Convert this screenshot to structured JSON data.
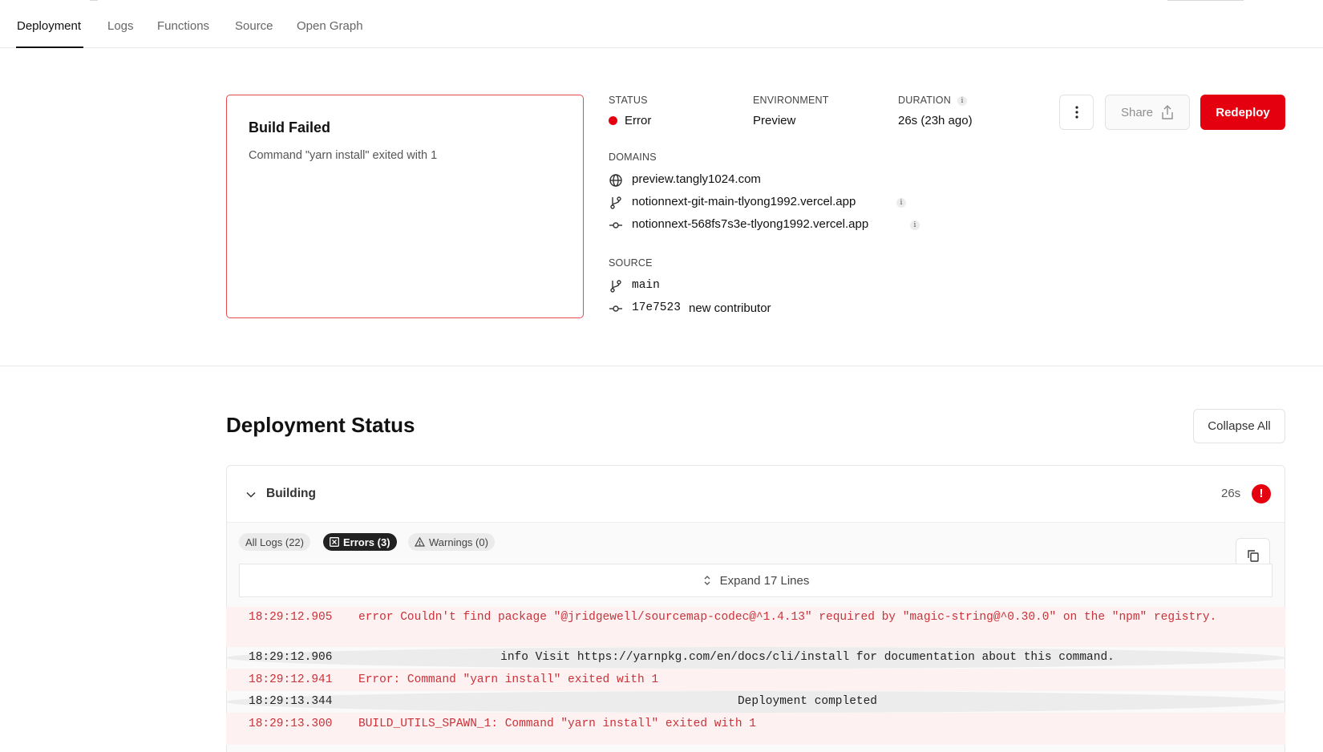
{
  "tabs": [
    "Deployment",
    "Logs",
    "Functions",
    "Source",
    "Open Graph"
  ],
  "build_card": {
    "title": "Build Failed",
    "description": "Command \"yarn install\" exited with 1"
  },
  "status": {
    "label": "STATUS",
    "value": "Error",
    "dot_color": "#e5000f"
  },
  "environment": {
    "label": "ENVIRONMENT",
    "value": "Preview"
  },
  "duration": {
    "label": "DURATION",
    "value": "26s (23h ago)"
  },
  "domains": {
    "label": "DOMAINS",
    "items": [
      {
        "icon": "globe-icon",
        "text": "preview.tangly1024.com"
      },
      {
        "icon": "git-branch-icon",
        "text": "notionnext-git-main-tlyong1992.vercel.app"
      },
      {
        "icon": "git-commit-icon",
        "text": "notionnext-568fs7s3e-tlyong1992.vercel.app"
      }
    ]
  },
  "source": {
    "label": "SOURCE",
    "branch": "main",
    "commit_hash": "17e7523",
    "commit_message": "new contributor"
  },
  "actions": {
    "share": "Share",
    "redeploy": "Redeploy"
  },
  "deployment_status": {
    "title": "Deployment Status",
    "collapse_all": "Collapse All",
    "section": "Building",
    "time": "26s",
    "filters": [
      "All Logs (22)",
      "Errors (3)",
      "Warnings (0)"
    ],
    "expand_lines": "Expand 17 Lines"
  },
  "logs": [
    {
      "time": "18:29:12.905",
      "message": "error Couldn't find package \"@jridgewell/sourcemap-codec@^1.4.13\" required by \"magic-string@^0.30.0\" on the \"npm\" registry.",
      "level": "error"
    },
    {
      "time": "18:29:12.906",
      "message": "info Visit https://yarnpkg.com/en/docs/cli/install for documentation about this command.",
      "level": "info"
    },
    {
      "time": "18:29:12.941",
      "message": "Error: Command \"yarn install\" exited with 1",
      "level": "error"
    },
    {
      "time": "18:29:13.344",
      "message": "Deployment completed",
      "level": "info"
    },
    {
      "time": "18:29:13.300",
      "message": "BUILD_UTILS_SPAWN_1: Command \"yarn install\" exited with 1",
      "level": "error"
    }
  ],
  "colors": {
    "accent_red": "#e5000f",
    "error_text": "#c8333a",
    "error_bg": "#fdf1f1"
  }
}
